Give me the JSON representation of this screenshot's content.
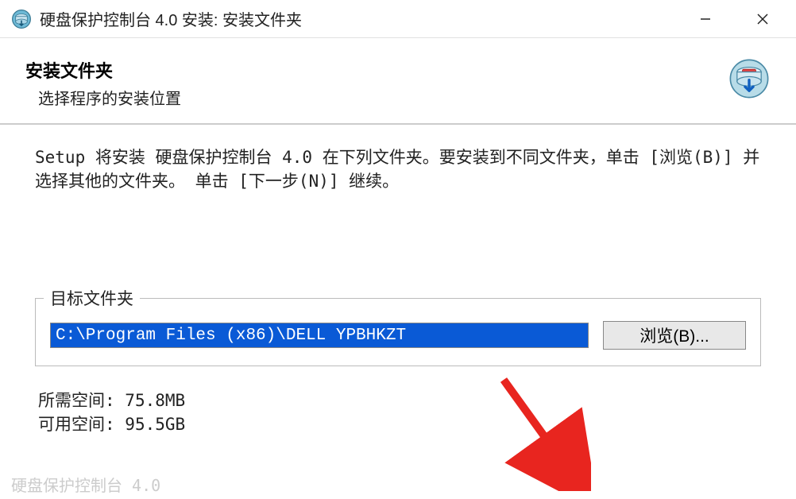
{
  "titlebar": {
    "title": "硬盘保护控制台 4.0 安装: 安装文件夹"
  },
  "header": {
    "heading": "安装文件夹",
    "subheading": "选择程序的安装位置"
  },
  "content": {
    "instructions": "Setup 将安装 硬盘保护控制台 4.0 在下列文件夹。要安装到不同文件夹，单击 [浏览(B)] 并选择其他的文件夹。 单击 [下一步(N)] 继续。"
  },
  "target": {
    "groupLabel": "目标文件夹",
    "path": "C:\\Program Files (x86)\\DELL YPBHKZT",
    "browseLabel": "浏览(B)..."
  },
  "space": {
    "requiredLabel": "所需空间: ",
    "requiredValue": "75.8MB",
    "availableLabel": "可用空间: ",
    "availableValue": "95.5GB"
  },
  "footer": {
    "brand": "硬盘保护控制台 4.0"
  }
}
